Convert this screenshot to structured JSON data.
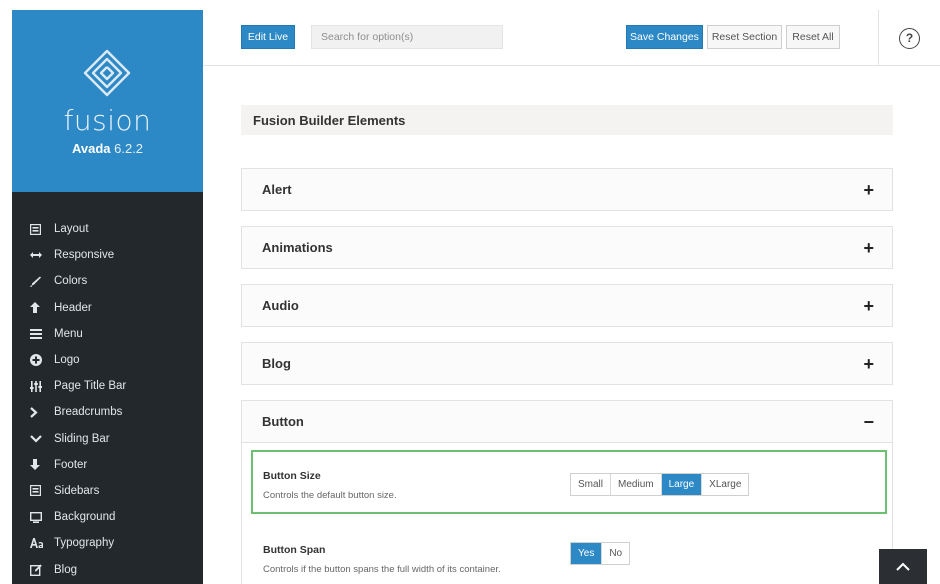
{
  "brand": {
    "name": "fusion",
    "product": "Avada",
    "version": "6.2.2"
  },
  "sidebar": {
    "items": [
      {
        "label": "Layout",
        "icon": "layout-icon"
      },
      {
        "label": "Responsive",
        "icon": "arrows-horizontal-icon"
      },
      {
        "label": "Colors",
        "icon": "brush-icon"
      },
      {
        "label": "Header",
        "icon": "arrow-up-icon"
      },
      {
        "label": "Menu",
        "icon": "hamburger-icon"
      },
      {
        "label": "Logo",
        "icon": "plus-circle-icon"
      },
      {
        "label": "Page Title Bar",
        "icon": "sliders-icon"
      },
      {
        "label": "Breadcrumbs",
        "icon": "chevron-right-icon"
      },
      {
        "label": "Sliding Bar",
        "icon": "chevron-down-icon"
      },
      {
        "label": "Footer",
        "icon": "arrow-down-icon"
      },
      {
        "label": "Sidebars",
        "icon": "sidebars-icon"
      },
      {
        "label": "Background",
        "icon": "monitor-icon"
      },
      {
        "label": "Typography",
        "icon": "typography-icon"
      },
      {
        "label": "Blog",
        "icon": "edit-icon"
      }
    ]
  },
  "toolbar": {
    "edit_live": "Edit Live",
    "search_placeholder": "Search for option(s)",
    "save_changes": "Save Changes",
    "reset_section": "Reset Section",
    "reset_all": "Reset All",
    "help": "?"
  },
  "main": {
    "section_title": "Fusion Builder Elements",
    "accordions": [
      {
        "label": "Alert",
        "sign": "+"
      },
      {
        "label": "Animations",
        "sign": "+"
      },
      {
        "label": "Audio",
        "sign": "+"
      },
      {
        "label": "Blog",
        "sign": "+"
      },
      {
        "label": "Button",
        "sign": "−"
      }
    ],
    "button_size": {
      "title": "Button Size",
      "description": "Controls the default button size.",
      "options": [
        "Small",
        "Medium",
        "Large",
        "XLarge"
      ],
      "selected": "Large"
    },
    "button_span": {
      "title": "Button Span",
      "description": "Controls if the button spans the full width of its container.",
      "options": [
        "Yes",
        "No"
      ],
      "selected": "Yes"
    }
  },
  "colors": {
    "accent": "#2d89c6",
    "sidebar_bg": "#23282d",
    "highlight": "#6cc070"
  }
}
